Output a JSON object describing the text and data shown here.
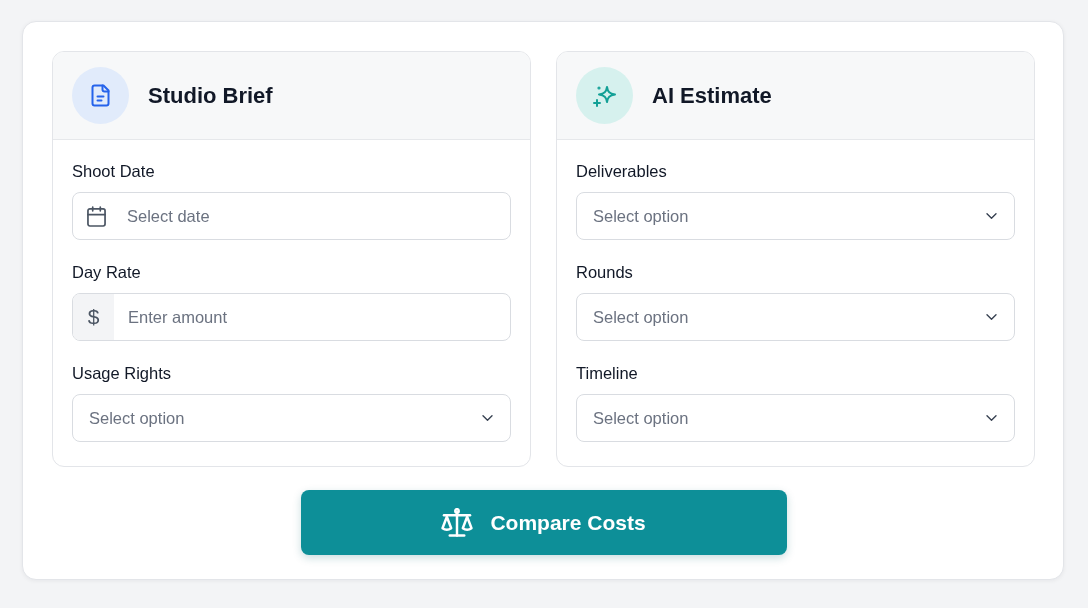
{
  "panels": [
    {
      "title": "Studio Brief",
      "fields": [
        {
          "label": "Shoot Date",
          "kind": "date",
          "placeholder": "Select date"
        },
        {
          "label": "Day Rate",
          "kind": "currency",
          "prefix": "$",
          "placeholder": "Enter amount"
        },
        {
          "label": "Usage Rights",
          "kind": "select",
          "placeholder": "Select option"
        }
      ]
    },
    {
      "title": "AI Estimate",
      "fields": [
        {
          "label": "Deliverables",
          "kind": "select",
          "placeholder": "Select option"
        },
        {
          "label": "Rounds",
          "kind": "select",
          "placeholder": "Select option"
        },
        {
          "label": "Timeline",
          "kind": "select",
          "placeholder": "Select option"
        }
      ]
    }
  ],
  "button": {
    "label": "Compare Costs"
  }
}
